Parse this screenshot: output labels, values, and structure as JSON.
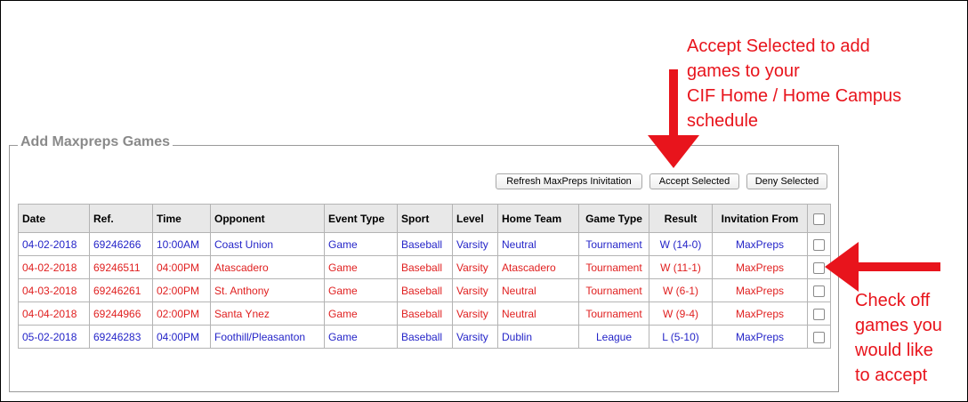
{
  "section": {
    "legend": "Add Maxpreps Games"
  },
  "toolbar": {
    "refresh_label": "Refresh MaxPreps Inivitation",
    "accept_label": "Accept Selected",
    "deny_label": "Deny Selected"
  },
  "table": {
    "headers": [
      "Date",
      "Ref.",
      "Time",
      "Opponent",
      "Event Type",
      "Sport",
      "Level",
      "Home Team",
      "Game Type",
      "Result",
      "Invitation From"
    ],
    "rows": [
      {
        "date": "04-02-2018",
        "ref": "69246266",
        "time": "10:00AM",
        "opponent": "Coast Union",
        "event_type": "Game",
        "sport": "Baseball",
        "level": "Varsity",
        "home_team": "Neutral",
        "game_type": "Tournament",
        "result": "W (14-0)",
        "invitation_from": "MaxPreps",
        "color": "#2424c8"
      },
      {
        "date": "04-02-2018",
        "ref": "69246511",
        "time": "04:00PM",
        "opponent": "Atascadero",
        "event_type": "Game",
        "sport": "Baseball",
        "level": "Varsity",
        "home_team": "Atascadero",
        "game_type": "Tournament",
        "result": "W (11-1)",
        "invitation_from": "MaxPreps",
        "color": "#e02020"
      },
      {
        "date": "04-03-2018",
        "ref": "69246261",
        "time": "02:00PM",
        "opponent": "St. Anthony",
        "event_type": "Game",
        "sport": "Baseball",
        "level": "Varsity",
        "home_team": "Neutral",
        "game_type": "Tournament",
        "result": "W (6-1)",
        "invitation_from": "MaxPreps",
        "color": "#e02020"
      },
      {
        "date": "04-04-2018",
        "ref": "69244966",
        "time": "02:00PM",
        "opponent": "Santa Ynez",
        "event_type": "Game",
        "sport": "Baseball",
        "level": "Varsity",
        "home_team": "Neutral",
        "game_type": "Tournament",
        "result": "W (9-4)",
        "invitation_from": "MaxPreps",
        "color": "#e02020"
      },
      {
        "date": "05-02-2018",
        "ref": "69246283",
        "time": "04:00PM",
        "opponent": "Foothill/Pleasanton",
        "event_type": "Game",
        "sport": "Baseball",
        "level": "Varsity",
        "home_team": "Dublin",
        "game_type": "League",
        "result": "L (5-10)",
        "invitation_from": "MaxPreps",
        "color": "#2424c8"
      }
    ]
  },
  "annotations": {
    "accept_note": [
      "Accept Selected to add",
      "games to your",
      "CIF Home / Home Campus",
      "schedule"
    ],
    "check_note": [
      "Check off",
      "games you",
      "would like",
      "to accept"
    ],
    "color": "#e8141c"
  }
}
